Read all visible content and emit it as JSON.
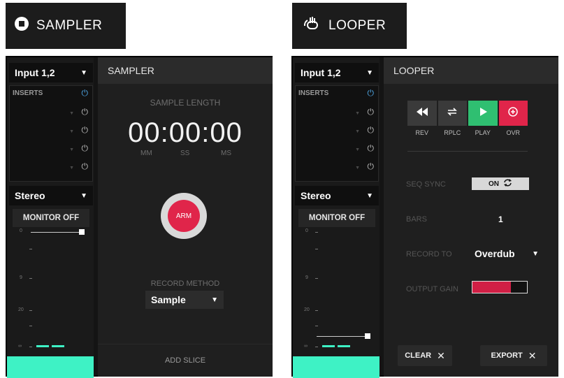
{
  "sampler_badge": {
    "label": "SAMPLER",
    "icon": "record-circle-icon"
  },
  "looper_badge": {
    "label": "LOOPER",
    "icon": "looper-hand-icon"
  },
  "sampler": {
    "input_select": "Input 1,2",
    "inserts_label": "INSERTS",
    "stereo_select": "Stereo",
    "monitor_button": "MONITOR OFF",
    "meter_ticks": [
      "0",
      "9",
      "20",
      "∞"
    ],
    "header_title": "SAMPLER",
    "sample_length_label": "SAMPLE LENGTH",
    "time_display": "00:00:00",
    "time_units": [
      "MM",
      "SS",
      "MS"
    ],
    "arm_label": "ARM",
    "record_method_label": "RECORD METHOD",
    "record_method_value": "Sample",
    "add_slice_label": "ADD SLICE"
  },
  "looper": {
    "input_select": "Input 1,2",
    "inserts_label": "INSERTS",
    "stereo_select": "Stereo",
    "monitor_button": "MONITOR OFF",
    "meter_ticks": [
      "0",
      "9",
      "20",
      "∞"
    ],
    "header_title": "LOOPER",
    "transport": [
      {
        "label": "REV",
        "icon": "rewind-icon",
        "color": "#3a3a3a"
      },
      {
        "label": "RPLC",
        "icon": "replace-icon",
        "color": "#3a3a3a"
      },
      {
        "label": "PLAY",
        "icon": "play-icon",
        "color": "#2fbf71"
      },
      {
        "label": "OVR",
        "icon": "overdub-plus-icon",
        "color": "#e0254a"
      }
    ],
    "seq_sync_label": "SEQ SYNC",
    "seq_sync_value": "ON",
    "bars_label": "BARS",
    "bars_value": "1",
    "record_to_label": "RECORD TO",
    "record_to_value": "Overdub",
    "output_gain_label": "OUTPUT GAIN",
    "output_gain_fraction": 0.7,
    "clear_label": "CLEAR",
    "export_label": "EXPORT"
  },
  "colors": {
    "accent_blue": "#4fa8e8",
    "meter_green": "#3ef2c5",
    "arm_red": "#e0254a",
    "gain_red": "#d11f45"
  }
}
